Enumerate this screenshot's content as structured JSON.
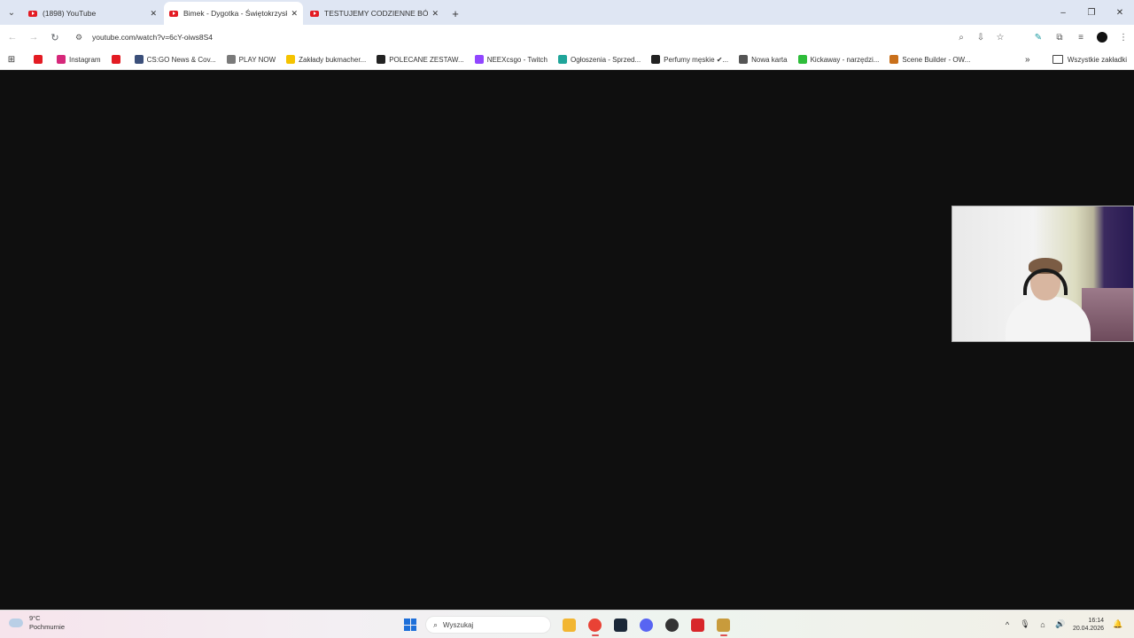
{
  "tabs": [
    {
      "title": "(1898) YouTube",
      "active": false
    },
    {
      "title": "Bimek - Dygotka - Świętokrzyska",
      "active": true
    },
    {
      "title": "TESTUJEMY CODZIENNE BÓLE",
      "active": false
    }
  ],
  "tab_icons": {
    "close": "✕",
    "new_tab": "+",
    "tab_search": "⌄"
  },
  "window_controls": {
    "minimize": "–",
    "maximize": "❐",
    "close": "✕"
  },
  "toolbar": {
    "back": "←",
    "forward": "→",
    "reload": "↻",
    "site_info_icon": "⚙",
    "url": "youtube.com/watch?v=6cY-oiws8S4",
    "zoom_icon": "⌕",
    "install_icon": "⇩",
    "star_icon": "☆",
    "ext1_icon": "✎",
    "ext2_icon": "⧉",
    "media_icon": "≡",
    "menu_icon": "⋮"
  },
  "bookmarks": {
    "apps_icon": "⊞",
    "items": [
      {
        "label": "",
        "color": "#e31b23"
      },
      {
        "label": "Instagram",
        "color": "#d6287a"
      },
      {
        "label": "",
        "color": "#e31b23"
      },
      {
        "label": "CS:GO News & Cov...",
        "color": "#3b4f7a"
      },
      {
        "label": "PLAY NOW",
        "color": "#7a7a7a"
      },
      {
        "label": "Zakłady bukmacher...",
        "color": "#f5c300"
      },
      {
        "label": "POLECANE ZESTAW...",
        "color": "#222222"
      },
      {
        "label": "NEEXcsgo - Twitch",
        "color": "#9146ff"
      },
      {
        "label": "Ogłoszenia - Sprzed...",
        "color": "#1fa59a"
      },
      {
        "label": "Perfumy męskie ✔...",
        "color": "#222222"
      },
      {
        "label": "Nowa karta",
        "color": "#555555"
      },
      {
        "label": "Kickaway - narzędzi...",
        "color": "#2ebd3a"
      },
      {
        "label": "Scene Builder - OW...",
        "color": "#c9701b"
      }
    ],
    "more_icon": "»",
    "all_bookmarks": "Wszystkie zakładki"
  },
  "taskbar": {
    "weather_temp": "9°C",
    "weather_desc": "Pochmurnie",
    "search_placeholder": "Wyszukaj",
    "search_icon": "⌕",
    "apps": [
      {
        "name": "file-explorer",
        "color": "#f2b632",
        "active": false
      },
      {
        "name": "chrome",
        "color": "#e94235",
        "active": true
      },
      {
        "name": "steam",
        "color": "#1b2838",
        "active": false
      },
      {
        "name": "discord",
        "color": "#5865f2",
        "active": false
      },
      {
        "name": "app-dark",
        "color": "#333333",
        "active": false
      },
      {
        "name": "app-red",
        "color": "#d8262a",
        "active": false
      },
      {
        "name": "league",
        "color": "#c89b3c",
        "active": true
      }
    ],
    "tray": {
      "chevron": "^",
      "mic": "🎙",
      "network": "⌂",
      "volume": "🔊",
      "bell": "🔔"
    },
    "time": "16:14",
    "date": "20.04.2026"
  }
}
